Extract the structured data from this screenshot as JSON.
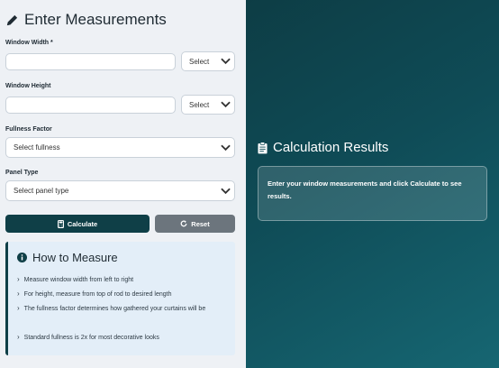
{
  "form": {
    "title": "Enter Measurements",
    "width": {
      "label": "Window Width *",
      "value": "",
      "unit": "Select"
    },
    "height": {
      "label": "Window Height",
      "value": "",
      "unit": "Select"
    },
    "fullness": {
      "label": "Fullness Factor",
      "selected": "Select fullness"
    },
    "panel": {
      "label": "Panel Type",
      "selected": "Select panel type"
    },
    "calculate_label": "Calculate",
    "reset_label": "Reset"
  },
  "how_to": {
    "title": "How to Measure",
    "tips": [
      "Measure window width from left to right",
      "For height, measure from top of rod to desired length",
      "The fullness factor determines how gathered your curtains will be",
      "Standard fullness is 2x for most decorative looks"
    ]
  },
  "results": {
    "title": "Calculation Results",
    "message": "Enter your window measurements and click Calculate to see results."
  },
  "colors": {
    "primary": "#0f3f47",
    "reset": "#6c757d",
    "panel_gradient_start": "#0d3d45",
    "panel_gradient_end": "#166672"
  }
}
